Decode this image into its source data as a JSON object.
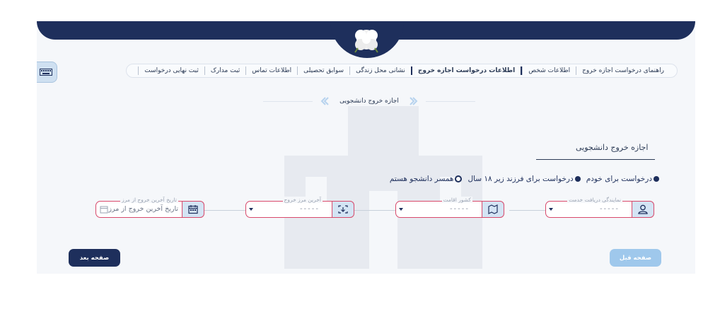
{
  "nav": {
    "items": [
      {
        "label": "راهنمای درخواست اجازه خروج"
      },
      {
        "label": "اطلاعات شخص"
      },
      {
        "label": "اطلاعات درخواست اجازه خروج"
      },
      {
        "label": "نشانی محل زندگی"
      },
      {
        "label": "سوابق تحصیلی"
      },
      {
        "label": "اطلاعات تماس"
      },
      {
        "label": "ثبت مدارک"
      },
      {
        "label": "ثبت نهایی درخواست"
      }
    ],
    "active_index": 2
  },
  "keyboard_button": {
    "icon": "keyboard-icon"
  },
  "section_title": "اجازه خروج دانشجویی",
  "form": {
    "heading": "اجازه خروج دانشجویی",
    "radio_options": [
      {
        "label": "درخواست برای خودم",
        "checked": false
      },
      {
        "label": "درخواست برای فرزند زیر ۱۸ سال",
        "checked": false
      },
      {
        "label": "همسر دانشجو هستم",
        "checked": true
      }
    ],
    "fields": {
      "service_office": {
        "label": "نمایندگی دریافت خدمت",
        "value": "-----",
        "icon": "user-icon"
      },
      "residence_country": {
        "label": "کشور اقامت",
        "value": "-----",
        "icon": "map-icon"
      },
      "exit_border": {
        "label": "آخرین مرز خروج",
        "value": "-----",
        "icon": "border-icon"
      },
      "exit_date": {
        "label": "تاریخ آخرین خروج از مرز",
        "placeholder": "تاریخ آخرین خروج از مرز",
        "icon": "calendar-icon"
      }
    }
  },
  "buttons": {
    "next": "صفحه بعد",
    "prev": "صفحه قبل"
  },
  "colors": {
    "primary": "#1e2f5c",
    "error_border": "#d8496b",
    "icon_bg": "#d4e4f4",
    "prev_button": "#9fc8ec"
  }
}
